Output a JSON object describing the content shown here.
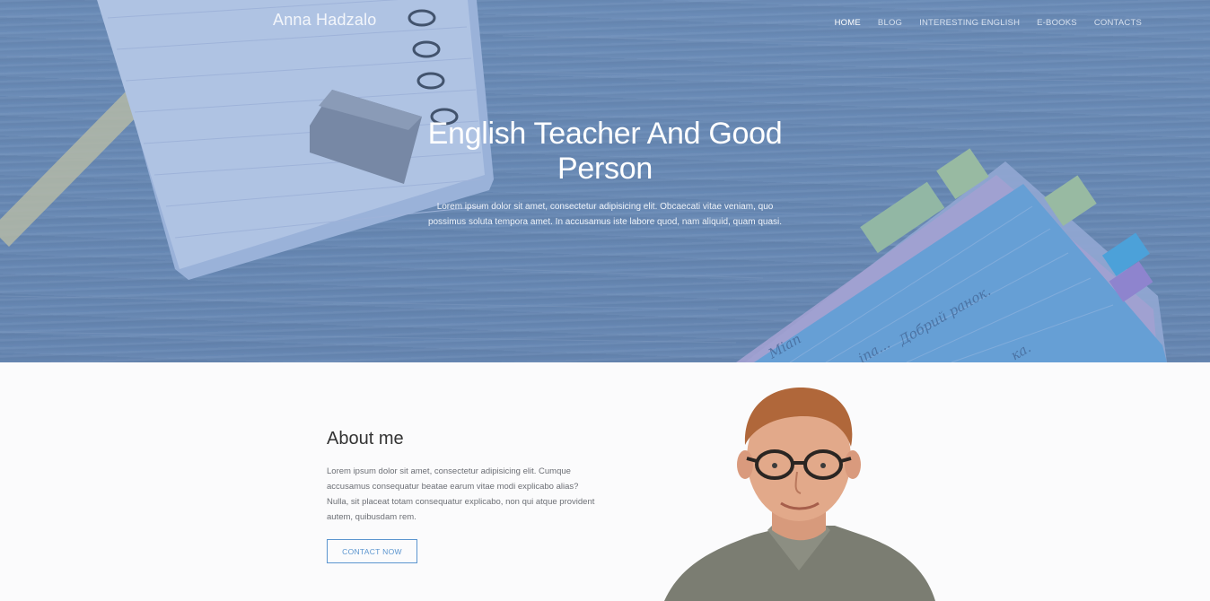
{
  "brand": {
    "name": "Anna Hadzalo"
  },
  "nav": {
    "items": [
      {
        "label": "HOME",
        "active": true
      },
      {
        "label": "BLOG"
      },
      {
        "label": "INTERESTING ENGLISH"
      },
      {
        "label": "E-BOOKS"
      },
      {
        "label": "CONTACTS"
      }
    ]
  },
  "hero": {
    "title": "English Teacher And Good Person",
    "text": "Lorem ipsum dolor sit amet, consectetur adipisicing elit. Obcaecati vitae veniam, quo possimus soluta tempora amet. In accusamus iste labore quod, nam aliquid, quam quasi.",
    "notebook_scribbles": [
      "Добрий ранок.",
      "Mian",
      "ina...",
      "ка."
    ]
  },
  "about": {
    "title": "About me",
    "text": "Lorem ipsum dolor sit amet, consectetur adipisicing elit. Cumque accusamus consequatur beatae earum vitae modi explicabo alias? Nulla, sit placeat totam consequatur explicabo, non qui atque provident autem, quibusdam rem.",
    "button_label": "CONTACT NOW"
  },
  "colors": {
    "hero_overlay": "#6b8bb3",
    "accent": "#5b95cf",
    "about_bg": "#fbfbfc"
  }
}
